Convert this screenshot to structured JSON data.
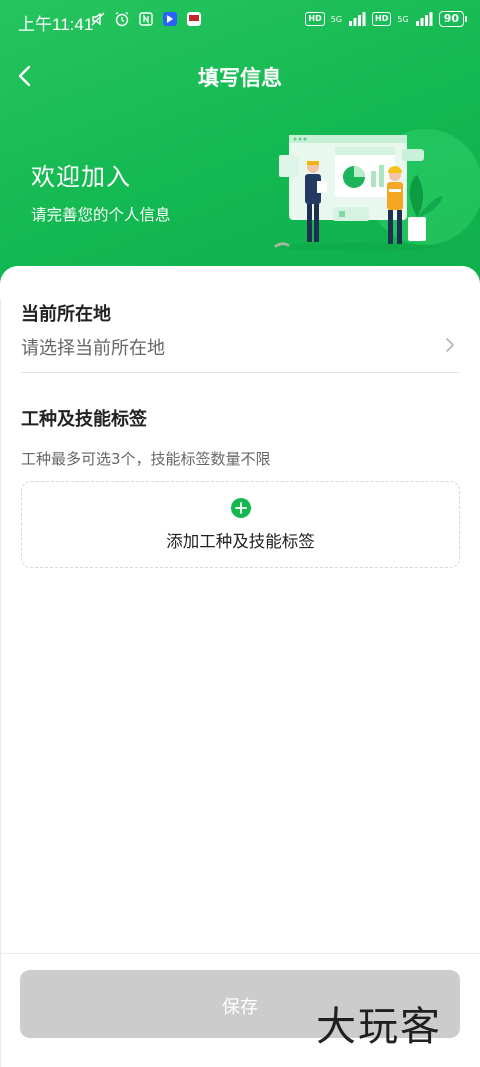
{
  "status_bar": {
    "time": "上午11:41",
    "network_5g_1": "5G",
    "network_5g_2": "5G",
    "hd_1": "HD",
    "hd_2": "HD",
    "battery": "90"
  },
  "nav": {
    "title": "填写信息",
    "back_icon": "chevron-left-icon"
  },
  "hero": {
    "welcome_title": "欢迎加入",
    "welcome_subtitle": "请完善您的个人信息",
    "gradient_colors": [
      "#27c45e",
      "#0fae4b"
    ]
  },
  "location": {
    "label": "当前所在地",
    "placeholder": "请选择当前所在地"
  },
  "skills": {
    "label": "工种及技能标签",
    "hint": "工种最多可选3个，技能标签数量不限",
    "add_label": "添加工种及技能标签",
    "accent_color": "#13b84e"
  },
  "footer": {
    "save_label": "保存",
    "watermark": "大玩客"
  }
}
